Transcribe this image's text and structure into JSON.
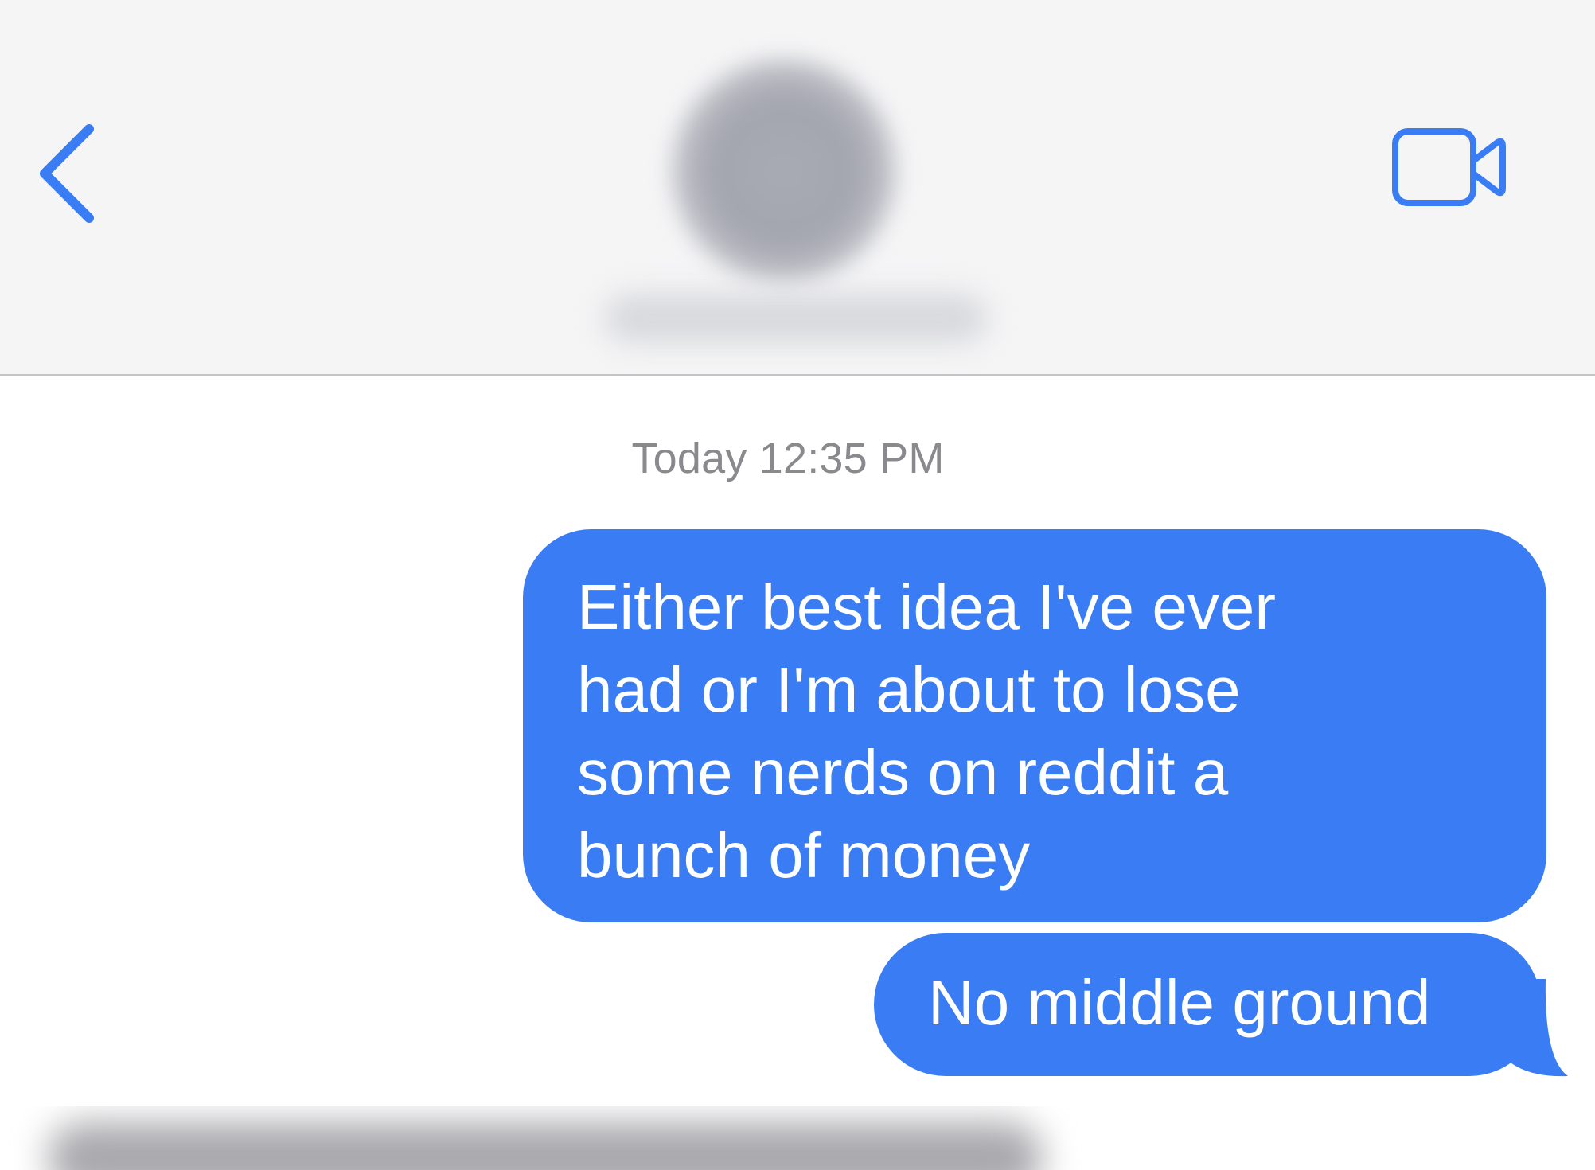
{
  "header": {
    "back_icon": "chevron-left-icon",
    "video_icon": "video-camera-icon",
    "avatar": "contact-avatar",
    "contact_name": ""
  },
  "conversation": {
    "timestamp": "Today 12:35 PM",
    "messages": [
      {
        "sender": "me",
        "text": "Either best idea I've ever\nhad or I'm about to lose\nsome nerds on reddit a\nbunch of money"
      },
      {
        "sender": "me",
        "text": "No middle ground"
      }
    ]
  },
  "colors": {
    "accent": "#3a7cf3",
    "header_bg": "#f5f5f6",
    "timestamp": "#8a8a8e"
  }
}
